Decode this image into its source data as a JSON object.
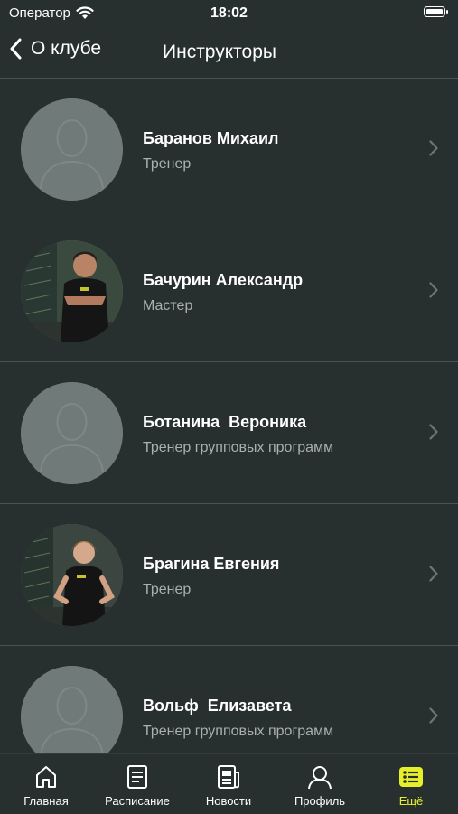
{
  "status_bar": {
    "carrier": "Оператор",
    "time": "18:02"
  },
  "nav": {
    "back_label": "О клубе",
    "title": "Инструкторы"
  },
  "instructors": [
    {
      "name": "Баранов Михаил",
      "role": "Тренер",
      "photo": "placeholder"
    },
    {
      "name": "Бачурин Александр",
      "role": "Мастер",
      "photo": "photo"
    },
    {
      "name": "Ботанина  Вероника",
      "role": "Тренер групповых программ",
      "photo": "placeholder"
    },
    {
      "name": "Брагина Евгения",
      "role": "Тренер",
      "photo": "photo"
    },
    {
      "name": "Вольф  Елизавета",
      "role": "Тренер групповых программ",
      "photo": "placeholder"
    }
  ],
  "tabs": [
    {
      "label": "Главная",
      "icon": "home-icon"
    },
    {
      "label": "Расписание",
      "icon": "schedule-icon"
    },
    {
      "label": "Новости",
      "icon": "news-icon"
    },
    {
      "label": "Профиль",
      "icon": "profile-icon"
    },
    {
      "label": "Ещё",
      "icon": "more-icon",
      "active": true
    }
  ],
  "colors": {
    "background": "#27302f",
    "accent": "#e6ef2a",
    "secondary_text": "#a9b0af"
  }
}
